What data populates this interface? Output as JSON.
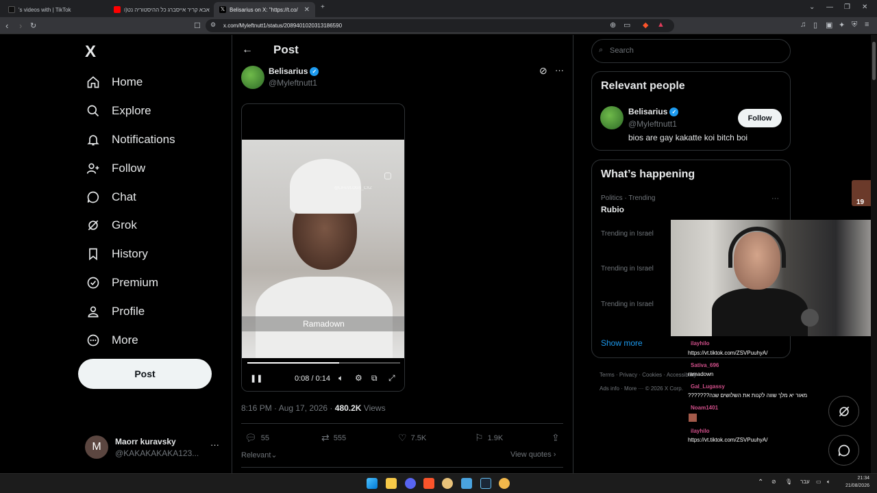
{
  "browser": {
    "tabs": [
      {
        "title": "'s videos with | TikTok"
      },
      {
        "title": "אבא קריר אייסברג כל ההיסטוריה נט(ו"
      },
      {
        "title": "Belisarius on X: \"https://t.co/"
      }
    ],
    "url": "x.com/Myleftnutt1/status/2089401020313186590"
  },
  "sidebar": {
    "logo": "X",
    "items": [
      {
        "label": "Home",
        "icon": "home-icon"
      },
      {
        "label": "Explore",
        "icon": "search-icon"
      },
      {
        "label": "Notifications",
        "icon": "bell-icon"
      },
      {
        "label": "Follow",
        "icon": "person-plus-icon"
      },
      {
        "label": "Chat",
        "icon": "chat-bubble-icon"
      },
      {
        "label": "Grok",
        "icon": "grok-icon"
      },
      {
        "label": "History",
        "icon": "bookmark-icon"
      },
      {
        "label": "Premium",
        "icon": "verified-badge-icon"
      },
      {
        "label": "Profile",
        "icon": "person-icon"
      },
      {
        "label": "More",
        "icon": "more-circle-icon"
      }
    ],
    "post_button": "Post",
    "account": {
      "initial": "M",
      "name": "Maorr kuravsky",
      "handle": "@KAKAKAKAKA123..."
    }
  },
  "main": {
    "header_title": "Post",
    "author": {
      "name": "Belisarius",
      "handle": "@Myleftnutt1"
    },
    "video": {
      "subtitle": "Ramadown",
      "time": "0:08 / 0:14",
      "progress": 0.6,
      "watermark": "@LIFEVLOGS_CXZ"
    },
    "timestamp": "8:16 PM · Aug 17, 2026 · ",
    "views_count": "480.2K",
    "views_label": " Views",
    "actions": {
      "replies": "55",
      "reposts": "555",
      "likes": "7.5K",
      "bookmarks": "1.9K"
    },
    "sort_label": "Relevant",
    "view_quotes": "View quotes"
  },
  "right": {
    "search_placeholder": "Search",
    "relevant_title": "Relevant people",
    "person": {
      "name": "Belisarius",
      "handle": "@Myleftnutt1",
      "bio": "bios are gay kakatte koi bitch boi",
      "follow_label": "Follow"
    },
    "happening_title": "What’s happening",
    "trends": [
      {
        "context": "Politics · Trending",
        "name": "Rubio"
      },
      {
        "context": "Trending in Israel",
        "name": ""
      },
      {
        "context": "Trending in Israel",
        "name": ""
      },
      {
        "context": "Trending in Israel",
        "name": ""
      }
    ],
    "show_more": "Show more",
    "footer_row1": [
      "Terms",
      "Privacy",
      "Cookies",
      "Accessibility"
    ],
    "footer_row2": [
      "Ads info",
      "More ···",
      "© 2026 X Corp."
    ]
  },
  "overlay": {
    "chat": [
      {
        "user": "ilayhilo",
        "msg": "https://vt.tiktok.com/ZSVPuuhyA/"
      },
      {
        "user": "Sativa_696",
        "msg": "ramadown"
      },
      {
        "user": "Gal_Lugassy",
        "msg": "מאור יא מלך שווה לקנות את השלושים שנה???????"
      },
      {
        "user": "Noam1401",
        "msg": ""
      },
      {
        "user": "ilayhilo",
        "msg": "https://vt.tiktok.com/ZSVPuuhyA/"
      }
    ],
    "viewer_badge": "19"
  },
  "taskbar": {
    "time": "21:34",
    "date": "21/08/2026",
    "lang": "עבר"
  }
}
